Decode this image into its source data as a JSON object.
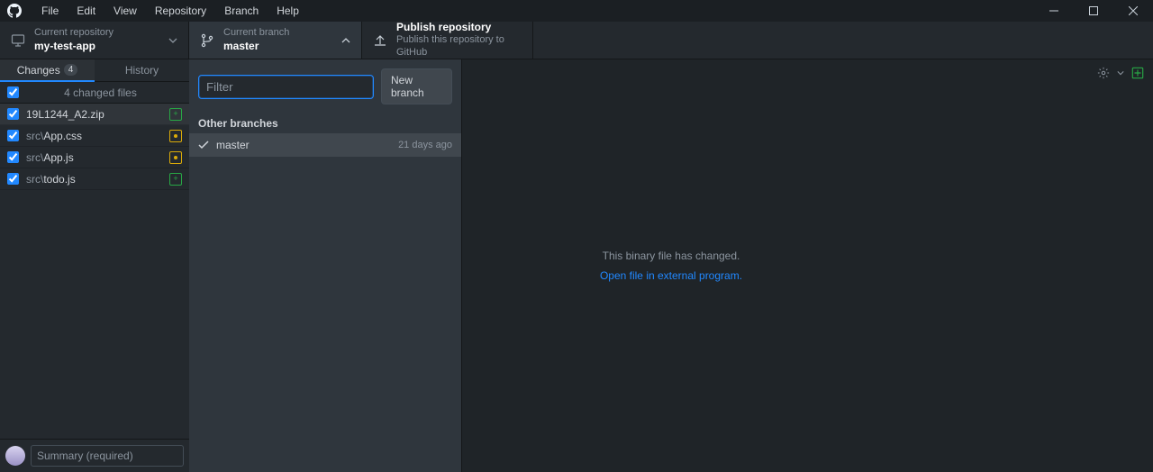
{
  "menu": {
    "file": "File",
    "edit": "Edit",
    "view": "View",
    "repository": "Repository",
    "branch": "Branch",
    "help": "Help"
  },
  "toolbar": {
    "repo": {
      "label": "Current repository",
      "value": "my-test-app"
    },
    "branch": {
      "label": "Current branch",
      "value": "master"
    },
    "publish": {
      "title": "Publish repository",
      "subtitle": "Publish this repository to GitHub"
    }
  },
  "sidebar": {
    "tabs": {
      "changes": "Changes",
      "changes_count": "4",
      "history": "History"
    },
    "header_label": "4 changed files",
    "files": [
      {
        "dir": "",
        "name": "19L1244_A2.zip",
        "status": "add"
      },
      {
        "dir": "src\\",
        "name": "App.css",
        "status": "mod"
      },
      {
        "dir": "src\\",
        "name": "App.js",
        "status": "mod"
      },
      {
        "dir": "src\\",
        "name": "todo.js",
        "status": "add"
      }
    ],
    "summary_placeholder": "Summary (required)"
  },
  "branch_panel": {
    "filter_placeholder": "Filter",
    "new_branch": "New branch",
    "section": "Other branches",
    "items": [
      {
        "name": "master",
        "time": "21 days ago"
      }
    ]
  },
  "diff": {
    "message": "This binary file has changed.",
    "link": "Open file in external program."
  }
}
